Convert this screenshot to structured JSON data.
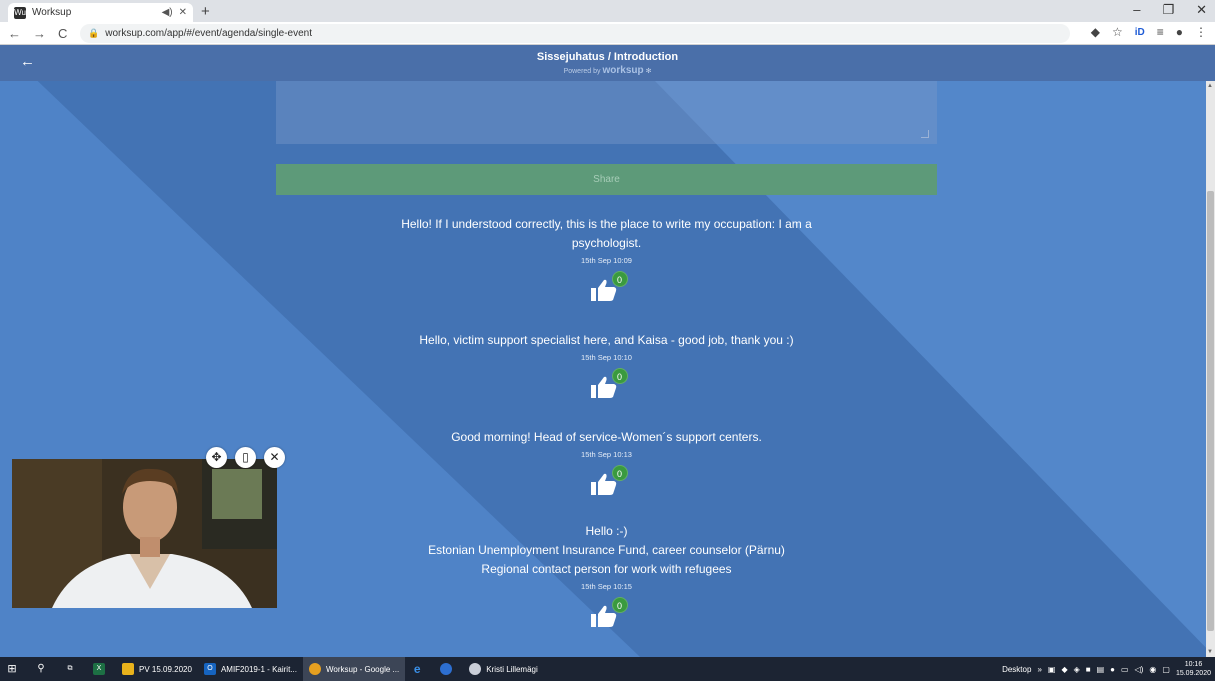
{
  "browser": {
    "tab_title": "Worksup",
    "tab_favicon": "Wu",
    "url": "worksup.com/app/#/event/agenda/single-event"
  },
  "header": {
    "title": "Sissejuhatus / Introduction",
    "powered_by": "Powered by",
    "brand": "worksup"
  },
  "composer": {
    "share_label": "Share"
  },
  "posts": [
    {
      "text": "Hello! If I understood correctly, this is the place to write my occupation: I am a psychologist.",
      "time": "15th Sep 10:09",
      "likes": "0"
    },
    {
      "text": "Hello, victim support specialist here, and Kaisa - good job, thank you :)",
      "time": "15th Sep 10:10",
      "likes": "0"
    },
    {
      "text": "Good morning! Head of service-Women´s support centers.",
      "time": "15th Sep 10:13",
      "likes": "0"
    },
    {
      "line1": "Hello :-)",
      "line2": "Estonian Unemployment Insurance Fund, career counselor (Pärnu)",
      "line3": "Regional contact person for work with refugees",
      "time": "15th Sep 10:15",
      "likes": "0"
    }
  ],
  "taskbar": {
    "items": [
      {
        "label": "PV 15.09.2020"
      },
      {
        "label": "AMIF2019-1 - Kairit..."
      },
      {
        "label": "Worksup - Google ..."
      },
      {
        "label": "Kristi Lillemägi"
      }
    ],
    "desktop_label": "Desktop",
    "time": "10:16",
    "date": "15.09.2020"
  },
  "colors": {
    "page_bg": "#4b7fc4",
    "header_bg": "#4a6fa9",
    "share_bg": "#5d9a79",
    "like_badge": "#3a9a3f"
  }
}
